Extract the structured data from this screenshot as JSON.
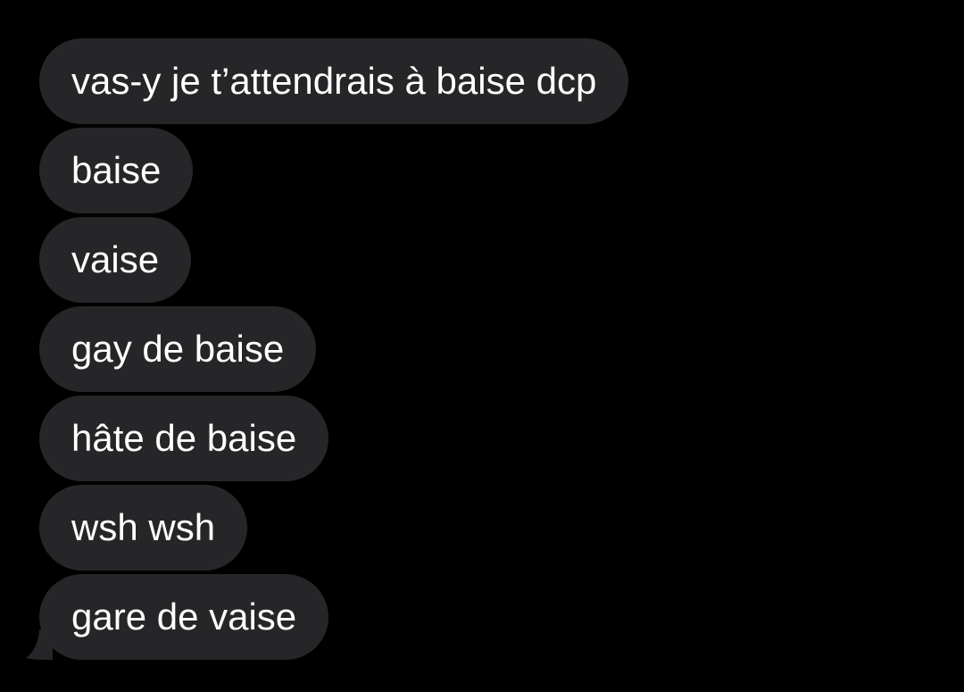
{
  "conversation": {
    "messages": [
      {
        "text": "vas-y je t’attendrais à baise dcp"
      },
      {
        "text": "baise"
      },
      {
        "text": "vaise"
      },
      {
        "text": "gay de baise"
      },
      {
        "text": "hâte de baise"
      },
      {
        "text": "wsh wsh"
      },
      {
        "text": "gare de vaise"
      }
    ]
  },
  "colors": {
    "background": "#000000",
    "bubble": "#262629",
    "text": "#ffffff"
  }
}
